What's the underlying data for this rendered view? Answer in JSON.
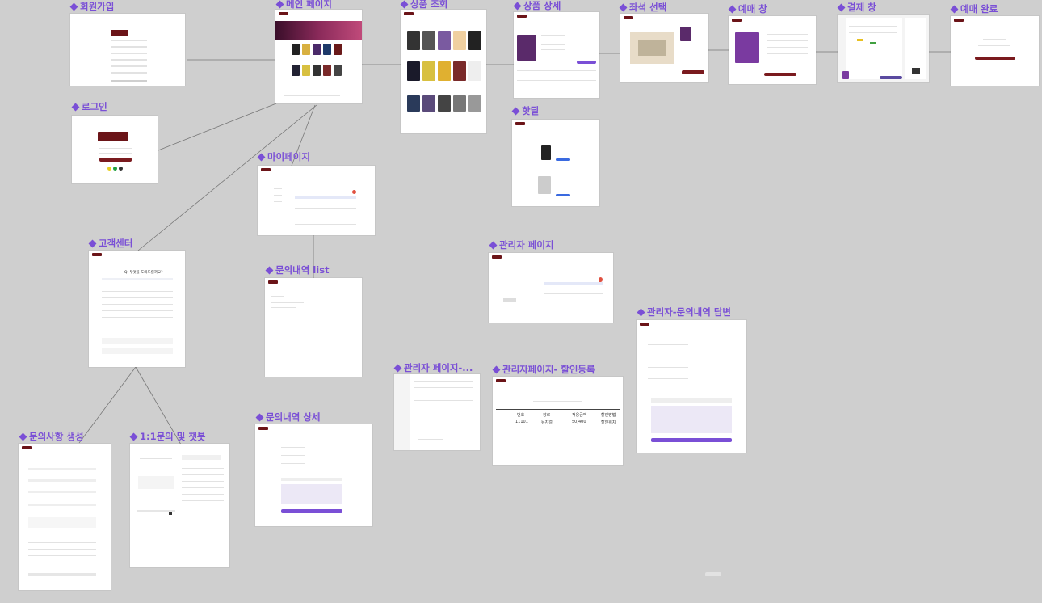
{
  "frames": {
    "signup": {
      "label": "회원가입"
    },
    "main": {
      "label": "메인 페이지"
    },
    "search": {
      "label": "상품 조회"
    },
    "detail": {
      "label": "상품 상세"
    },
    "seat": {
      "label": "좌석 선택"
    },
    "reserve": {
      "label": "예매 창"
    },
    "payment": {
      "label": "결제 창"
    },
    "done": {
      "label": "예매 완료"
    },
    "login": {
      "label": "로그인"
    },
    "hotdeal": {
      "label": "핫딜"
    },
    "mypage": {
      "label": "마이페이지"
    },
    "cs": {
      "label": "고객센터"
    },
    "inquiry_list": {
      "label": "문의내역 list"
    },
    "admin": {
      "label": "관리자 페이지"
    },
    "admin_answer": {
      "label": "관리자-문의내역 답변"
    },
    "admin_sub": {
      "label": "관리자 페이지-..."
    },
    "admin_discount": {
      "label": "관리자페이지- 할인등록"
    },
    "inquiry_detail": {
      "label": "문의내역 상세"
    },
    "inquiry_write": {
      "label": "문의사항 생성"
    },
    "chatbot": {
      "label": "1:1문의 및 챗봇"
    }
  },
  "cs_page": {
    "question": "Q. 무엇을 도와드릴까요?"
  },
  "discount_table": {
    "headers": [
      "번호",
      "장르",
      "적용금액",
      "할인방법"
    ],
    "row": [
      "11101",
      "뮤지컬",
      "50,400",
      "할인위치"
    ]
  },
  "colors": {
    "background": "#cfcfcf",
    "label": "#7a4fd6",
    "brand": "#6b1418",
    "accent": "#7a4fd6"
  }
}
